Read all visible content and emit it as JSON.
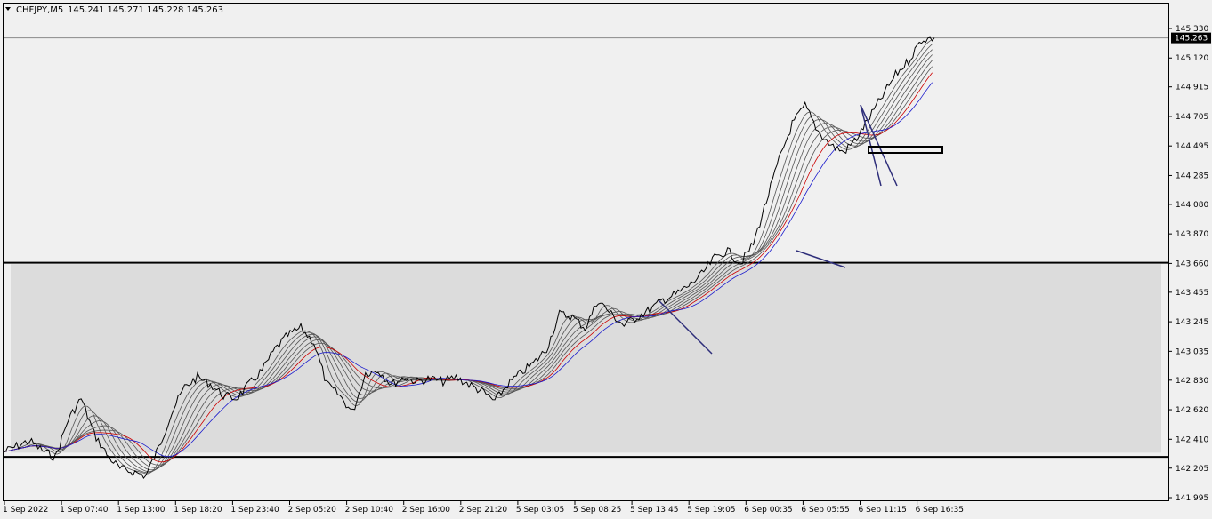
{
  "header": {
    "symbol": "CHFJPY,M5",
    "ohlc": "145.241 145.271 145.228 145.263"
  },
  "current_price_label": "145.263",
  "colors": {
    "background": "#f0f0f0",
    "candle": "#000000",
    "zone_fill": "#dcdcdc",
    "trend_lines": "#2e2e7a",
    "ma_red": "#cc0000",
    "ma_blue": "#1a1acc",
    "ma_gray": "#555555",
    "current_price_line": "#8a8a8a",
    "current_price_tag": "#000000"
  },
  "chart_data": {
    "type": "line",
    "title": "CHFJPY,M5",
    "ylim": [
      141.995,
      145.435
    ],
    "y_ticks": [
      "145.330",
      "145.120",
      "144.915",
      "144.705",
      "144.495",
      "144.285",
      "144.080",
      "143.870",
      "143.660",
      "143.455",
      "143.245",
      "143.035",
      "142.830",
      "142.620",
      "142.410",
      "142.205",
      "141.995"
    ],
    "x_ticks": [
      "1 Sep 2022",
      "1 Sep 07:40",
      "1 Sep 13:00",
      "1 Sep 18:20",
      "1 Sep 23:40",
      "2 Sep 05:20",
      "2 Sep 10:40",
      "2 Sep 16:00",
      "2 Sep 21:20",
      "5 Sep 03:05",
      "5 Sep 08:25",
      "5 Sep 13:45",
      "5 Sep 19:05",
      "6 Sep 00:35",
      "6 Sep 05:55",
      "6 Sep 11:15",
      "6 Sep 16:35"
    ],
    "series": [
      {
        "values": [
          142.32,
          142.36,
          142.4,
          142.33,
          142.28,
          142.55,
          142.7,
          142.45,
          142.3,
          142.2,
          142.18,
          142.15,
          142.35,
          142.6,
          142.78,
          142.85,
          142.8,
          142.72,
          142.7,
          142.8,
          142.9,
          143.05,
          143.15,
          143.2,
          143.1,
          142.8,
          142.72,
          142.6,
          142.88,
          142.9,
          142.8,
          142.85,
          142.82,
          142.84,
          142.82,
          142.85,
          142.8,
          142.75,
          142.68,
          142.8,
          142.88,
          142.95,
          143.05,
          143.3,
          143.28,
          143.2,
          143.4,
          143.3,
          143.22,
          143.28,
          143.33,
          143.4,
          143.44,
          143.5,
          143.58,
          143.7,
          143.75,
          143.66,
          143.8,
          144.1,
          144.4,
          144.65,
          144.78,
          144.6,
          144.5,
          144.45,
          144.55,
          144.7,
          144.85,
          145.0,
          145.1,
          145.25,
          145.263
        ]
      }
    ],
    "horizontal_levels": [
      143.665,
      142.285
    ],
    "zone": {
      "from": 142.315,
      "to": 143.655
    },
    "current_price": 145.263
  }
}
